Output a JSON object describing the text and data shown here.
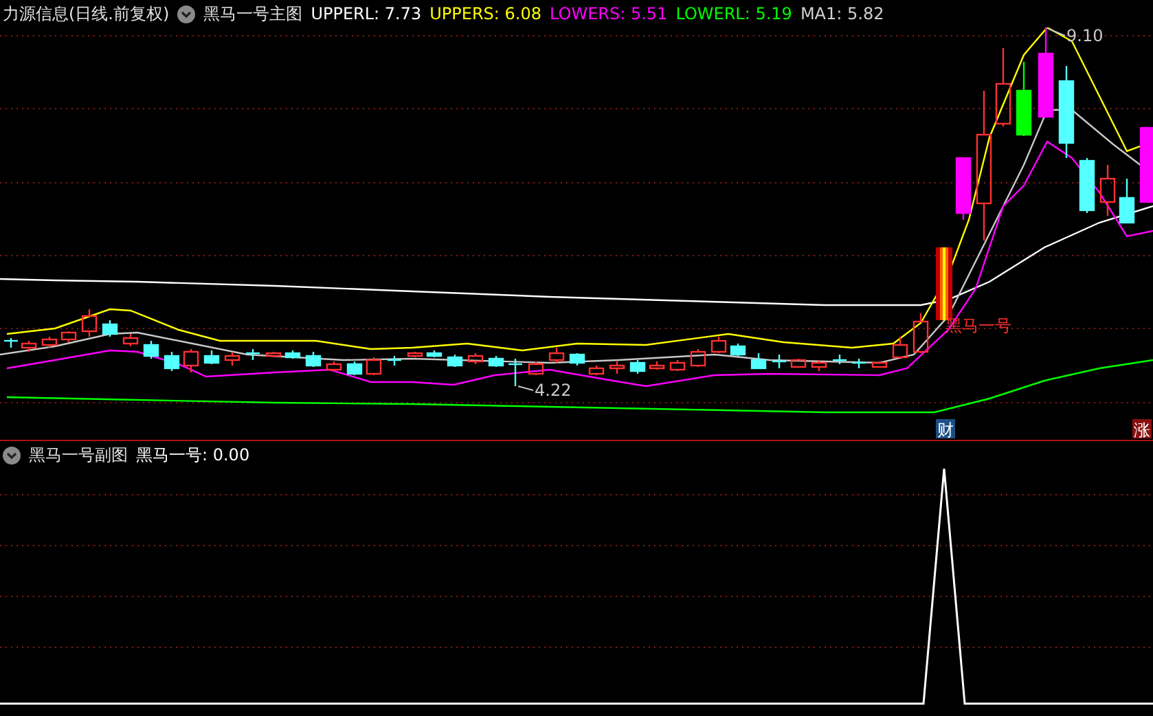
{
  "header": {
    "stock": "力源信息(日线.前复权)",
    "indicator": "黑马一号主图",
    "values": [
      {
        "label": "UPPERL: 7.73",
        "color": "#ffffff"
      },
      {
        "label": "UPPERS: 6.08",
        "color": "#ffff00"
      },
      {
        "label": "LOWERS: 5.51",
        "color": "#ff00ff"
      },
      {
        "label": "LOWERL: 5.19",
        "color": "#00ff00"
      },
      {
        "label": "MA1: 5.82",
        "color": "#d0d0d0"
      }
    ]
  },
  "main_chart": {
    "annotations": [
      {
        "kind": "high",
        "text": "9.10"
      },
      {
        "kind": "low",
        "text": "4.22"
      },
      {
        "kind": "signal",
        "text": "黑马一号"
      }
    ],
    "badges": [
      {
        "text": "财",
        "color": "#1c4f86"
      },
      {
        "text": "涨",
        "color": "#8b1010"
      }
    ]
  },
  "sub_chart": {
    "indicator": "黑马一号副图",
    "values": [
      {
        "label": "黑马一号: 0.00",
        "color": "#ffffff"
      }
    ]
  }
}
